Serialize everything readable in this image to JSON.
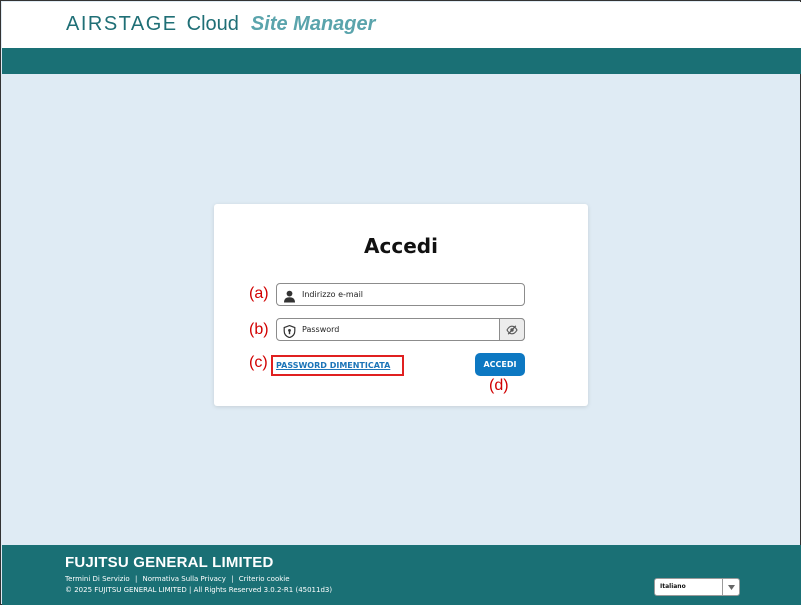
{
  "header": {
    "brand_airstage": "AIRSTAGE",
    "brand_cloud": "Cloud",
    "brand_site_manager": "Site Manager"
  },
  "login": {
    "title": "Accedi",
    "email_placeholder": "Indirizzo e-mail",
    "password_placeholder": "Password",
    "forgot_password_label": "PASSWORD DIMENTICATA",
    "submit_label": "ACCEDI"
  },
  "callouts": {
    "a": "(a)",
    "b": "(b)",
    "c": "(c)",
    "d": "(d)"
  },
  "footer": {
    "company": "FUJITSU GENERAL LIMITED",
    "links": [
      "Termini Di Servizio",
      "Normativa Sulla Privacy",
      "Criterio cookie"
    ],
    "separator": "|",
    "copyright": "© 2025 FUJITSU GENERAL LIMITED | All Rights Reserved 3.0.2-R1 (45011d3)",
    "language": "Italiano"
  },
  "icons": {
    "email": "user-icon",
    "password": "shield-icon",
    "toggle_password": "eye-slash-icon",
    "language_dropdown": "chevron-down-icon"
  },
  "colors": {
    "teal_band": "#1a7075",
    "brand_primary": "#1f6f76",
    "brand_accent": "#5aa4ac",
    "page_background": "#dfebf4",
    "accedi_button": "#0d78c2",
    "link": "#1b74b8",
    "callout": "#d10000"
  }
}
